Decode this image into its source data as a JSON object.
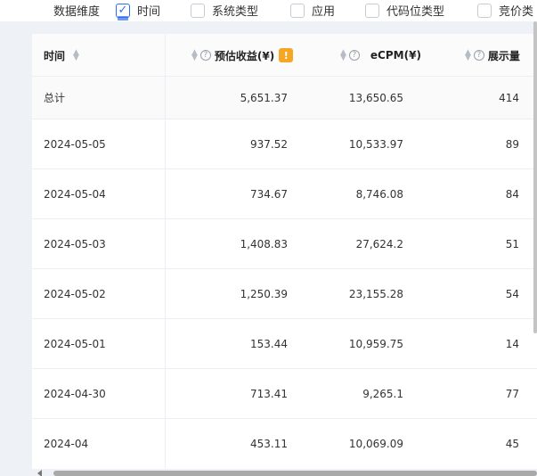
{
  "dimension_bar": {
    "label": "数据维度",
    "options": [
      {
        "label": "时间",
        "checked": true
      },
      {
        "label": "系统类型",
        "checked": false
      },
      {
        "label": "应用",
        "checked": false
      },
      {
        "label": "代码位类型",
        "checked": false
      },
      {
        "label": "竞价类",
        "checked": false
      }
    ]
  },
  "table": {
    "headers": {
      "date": "时间",
      "revenue": "预估收益(¥)",
      "ecpm": "eCPM(¥)",
      "impressions": "展示量"
    },
    "warning_badge": "!",
    "help_icon": "?",
    "total": {
      "date": "总计",
      "revenue": "5,651.37",
      "ecpm": "13,650.65",
      "impressions": "414"
    },
    "rows": [
      {
        "date": "2024-05-05",
        "revenue": "937.52",
        "ecpm": "10,533.97",
        "impressions": "89"
      },
      {
        "date": "2024-05-04",
        "revenue": "734.67",
        "ecpm": "8,746.08",
        "impressions": "84"
      },
      {
        "date": "2024-05-03",
        "revenue": "1,408.83",
        "ecpm": "27,624.2",
        "impressions": "51"
      },
      {
        "date": "2024-05-02",
        "revenue": "1,250.39",
        "ecpm": "23,155.28",
        "impressions": "54"
      },
      {
        "date": "2024-05-01",
        "revenue": "153.44",
        "ecpm": "10,959.75",
        "impressions": "14"
      },
      {
        "date": "2024-04-30",
        "revenue": "713.41",
        "ecpm": "9,265.1",
        "impressions": "77"
      },
      {
        "date": "2024-04",
        "revenue": "453.11",
        "ecpm": "10,069.09",
        "impressions": "45"
      }
    ]
  },
  "colors": {
    "accent": "#2f6cf0",
    "warning": "#f5a623"
  }
}
